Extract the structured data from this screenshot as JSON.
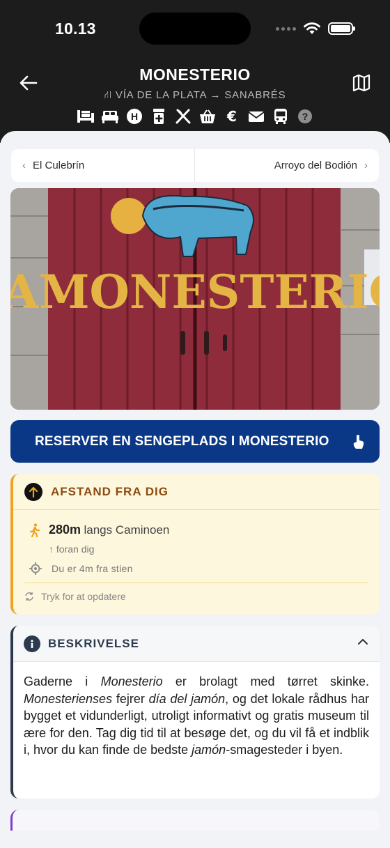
{
  "status_bar": {
    "time": "10.13"
  },
  "header": {
    "title": "MONESTERIO",
    "subtitle": "VÍA DE LA PLATA → SANABRÉS",
    "services": [
      "albergue-icon",
      "bed-icon",
      "hostal-icon",
      "pharmacy-icon",
      "restaurant-icon",
      "shop-basket-icon",
      "euro-icon",
      "mail-icon",
      "bus-icon",
      "help-icon"
    ]
  },
  "nav": {
    "prev": "El Culebrín",
    "next": "Arroyo del Bodión"
  },
  "photo": {
    "sign_text": "JAMONESTERIO"
  },
  "reserve": {
    "label": "RESERVER EN SENGEPLADS I MONESTERIO"
  },
  "distance": {
    "title": "AFSTAND FRA DIG",
    "value": "280m",
    "along": "langs Caminoen",
    "direction": "↑ foran dig",
    "off_path": "Du er 4m fra stien",
    "refresh": "Tryk for at opdatere"
  },
  "description": {
    "title": "BESKRIVELSE",
    "t1": "Gaderne i ",
    "t2": "Monesterio",
    "t3": " er brolagt med tørret skinke. ",
    "t4": "Monesterienses",
    "t5": " fejrer ",
    "t6": "día del jamón",
    "t7": ", og det lokale rådhus har bygget et vidunderligt, utroligt informativt og gratis museum til ære for den. Tag dig tid til at besøge det, og du vil få et indblik i, hvor du kan finde de bedste ",
    "t8": "jamón",
    "t9": "-smagesteder i byen."
  },
  "colors": {
    "header_bg": "#1c1c1c",
    "reserve_bg": "#0a3886",
    "distance_bg": "#fdf7dd",
    "distance_accent": "#f0a323",
    "description_accent": "#2c3a4e"
  }
}
